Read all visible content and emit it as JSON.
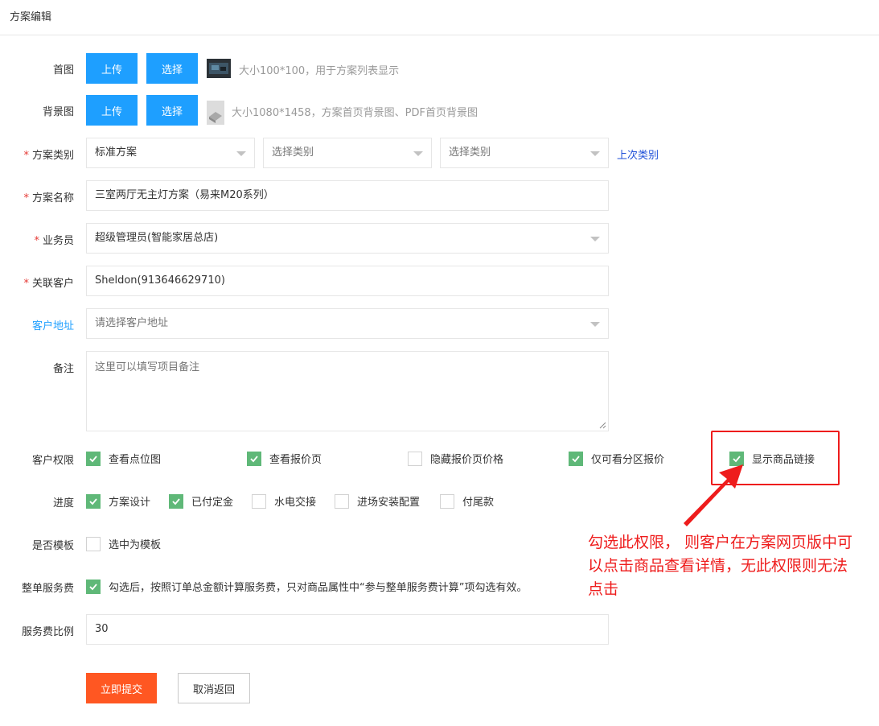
{
  "header": {
    "title": "方案编辑"
  },
  "cover": {
    "label": "首图",
    "upload_label": "上传",
    "select_label": "选择",
    "hint": "大小100*100，用于方案列表显示"
  },
  "background": {
    "label": "背景图",
    "upload_label": "上传",
    "select_label": "选择",
    "hint": "大小1080*1458，方案首页背景图、PDF首页背景图"
  },
  "category": {
    "label": "方案类别",
    "required": "*",
    "select1": "标准方案",
    "select2_placeholder": "选择类别",
    "select3_placeholder": "选择类别",
    "last_link": "上次类别"
  },
  "name": {
    "label": "方案名称",
    "required": "*",
    "value": "三室两厅无主灯方案（易来M20系列）"
  },
  "salesperson": {
    "label": "业务员",
    "required": "*",
    "value": "超级管理员(智能家居总店)"
  },
  "customer": {
    "label": "关联客户",
    "required": "*",
    "value": "Sheldon(913646629710)"
  },
  "address": {
    "label": "客户地址",
    "placeholder": "请选择客户地址"
  },
  "remark": {
    "label": "备注",
    "placeholder": "这里可以填写项目备注"
  },
  "permissions": {
    "label": "客户权限",
    "items": [
      {
        "label": "查看点位图",
        "checked": true
      },
      {
        "label": "查看报价页",
        "checked": true
      },
      {
        "label": "隐藏报价页价格",
        "checked": false
      },
      {
        "label": "仅可看分区报价",
        "checked": true
      },
      {
        "label": "显示商品链接",
        "checked": true
      }
    ]
  },
  "progress": {
    "label": "进度",
    "items": [
      {
        "label": "方案设计",
        "checked": true
      },
      {
        "label": "已付定金",
        "checked": true
      },
      {
        "label": "水电交接",
        "checked": false
      },
      {
        "label": "进场安装配置",
        "checked": false
      },
      {
        "label": "付尾款",
        "checked": false
      }
    ]
  },
  "template": {
    "label": "是否模板",
    "option": "选中为模板",
    "checked": false
  },
  "service_fee": {
    "label": "整单服务费",
    "checked": true,
    "text": "勾选后，按照订单总金额计算服务费，只对商品属性中“参与整单服务费计算”项勾选有效。"
  },
  "fee_ratio": {
    "label": "服务费比例",
    "value": "30"
  },
  "actions": {
    "submit_label": "立即提交",
    "cancel_label": "取消返回"
  },
  "annotation": {
    "text": "勾选此权限， 则客户在方案网页版中可以点击商品查看详情，无此权限则无法点击",
    "color": "#ee1c1c"
  },
  "colors": {
    "primary": "#1e9fff",
    "checked": "#5fb878",
    "submit": "#ff5722",
    "required": "#e53935"
  }
}
